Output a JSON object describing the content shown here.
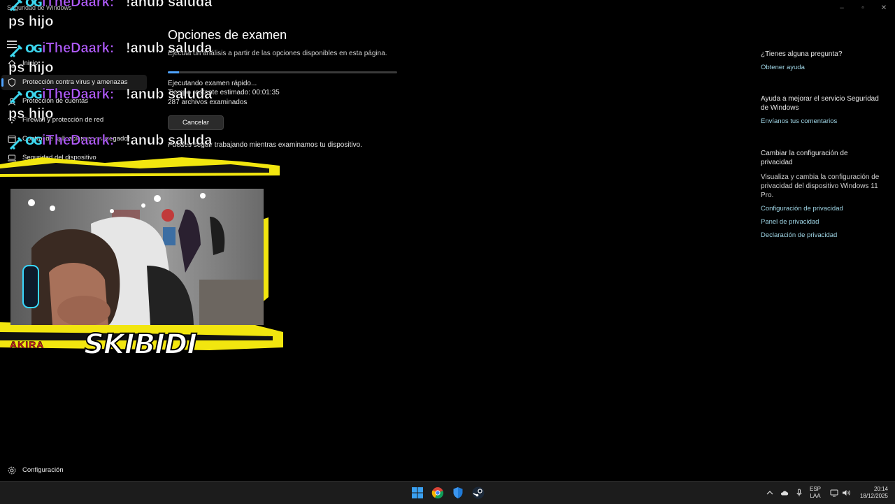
{
  "window": {
    "title": "Seguridad de Windows",
    "controls": {
      "minimize": "–",
      "maximize": "▫",
      "close": "✕"
    }
  },
  "sidebar": {
    "items": [
      {
        "label": "Inicio",
        "icon": "home-icon"
      },
      {
        "label": "Protección contra virus y amenazas",
        "icon": "shield-icon",
        "active": true
      },
      {
        "label": "Protección de cuentas",
        "icon": "person-icon"
      },
      {
        "label": "Firewall y protección de red",
        "icon": "wifi-icon"
      },
      {
        "label": "Control de aplicaciones y navegador",
        "icon": "app-window-icon"
      },
      {
        "label": "Seguridad del dispositivo",
        "icon": "laptop-icon"
      }
    ],
    "settings_label": "Configuración"
  },
  "main": {
    "title": "Opciones de examen",
    "subtitle": "Ejecuta un análisis a partir de las opciones disponibles en esta página.",
    "progress": 0.05,
    "status": "Ejecutando examen rápido...",
    "time_remaining": "Tiempo restante estimado: 00:01:35",
    "files_scanned": "287 archivos examinados",
    "cancel_label": "Cancelar",
    "continue_text": "Puedes seguir trabajando mientras examinamos tu dispositivo."
  },
  "right_panel": {
    "question_heading": "¿Tienes alguna pregunta?",
    "help_link": "Obtener ayuda",
    "improve_heading": "Ayuda a mejorar el servicio Seguridad de Windows",
    "feedback_link": "Envíanos tus comentarios",
    "privacy_heading": "Cambiar la configuración de privacidad",
    "privacy_text": "Visualiza y cambia la configuración de privacidad del dispositivo Windows 11 Pro.",
    "privacy_links": [
      "Configuración de privacidad",
      "Panel de privacidad",
      "Declaración de privacidad"
    ]
  },
  "chat_overlay": {
    "badge_text": "OG",
    "messages": [
      {
        "user": "iTheDaark:",
        "text": "!anub saluda",
        "line2": "ps hijo"
      },
      {
        "user": "iTheDaark:",
        "text": "!anub saluda",
        "line2": "ps hijo"
      },
      {
        "user": "iTheDaark:",
        "text": "!anub saluda",
        "line2": "ps hijo"
      },
      {
        "user": "iTheDaark:",
        "text": "!anub saluda",
        "line2": ""
      }
    ]
  },
  "webcam": {
    "logo_text": "SKIBIDI",
    "tag_text": "AKIRA",
    "frame_color": "#f2e60f"
  },
  "taskbar": {
    "apps": [
      "windows-start-icon",
      "chrome-icon",
      "defender-icon",
      "steam-icon"
    ],
    "language": "ESP",
    "layout": "LAA",
    "time": "20:14",
    "date": "18/12/2025"
  },
  "colors": {
    "accent": "#4fa3ff",
    "link": "#9fd5e5",
    "chat_user": "#b35cff",
    "chat_badge": "#3cd6ee"
  }
}
